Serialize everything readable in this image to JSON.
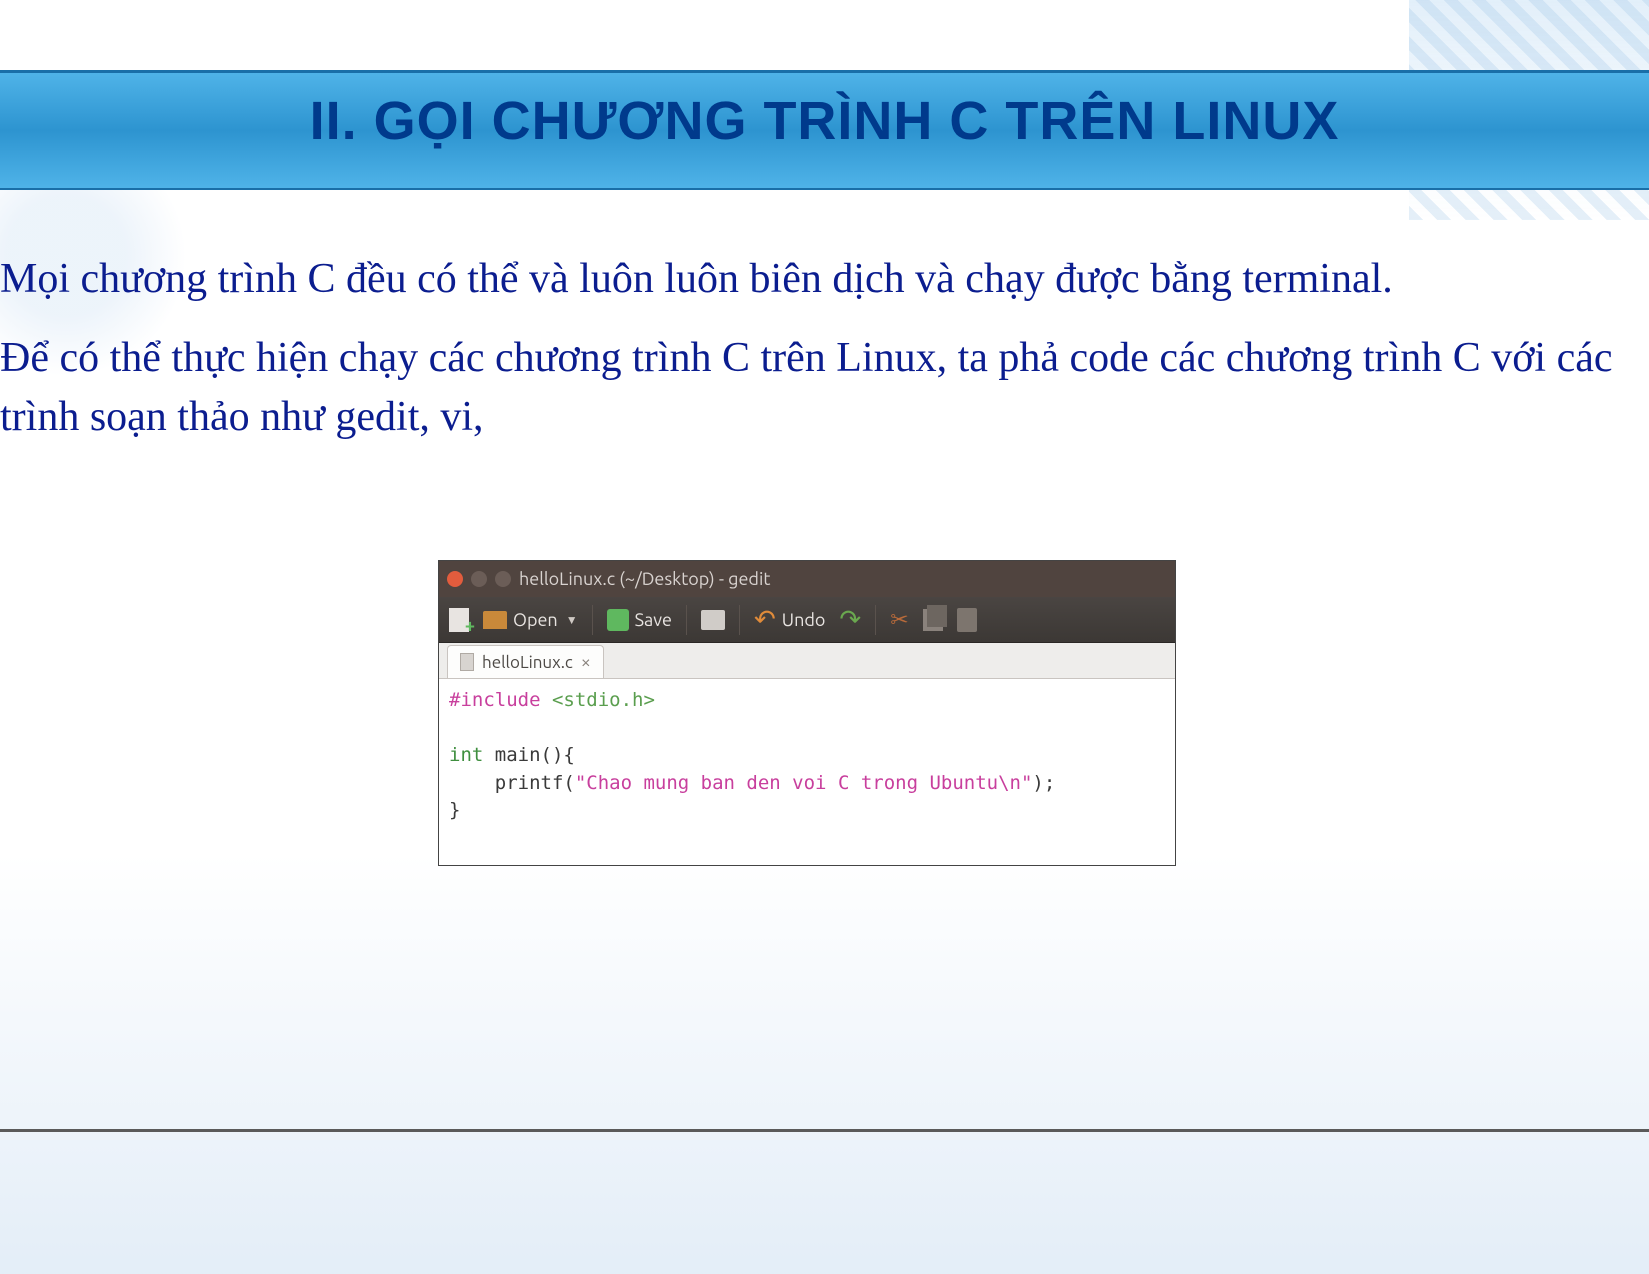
{
  "slide": {
    "title": "II. GỌI CHƯƠNG TRÌNH C TRÊN LINUX",
    "paragraph1": "Mọi chương trình C đều có thể và luôn luôn biên dịch và chạy được bằng terminal.",
    "paragraph2": "Để có thể thực hiện chạy các chương trình C trên Linux, ta phả code các chương trình C với các trình soạn thảo như gedit, vi,"
  },
  "editor": {
    "window_title": "helloLinux.c (~/Desktop) - gedit",
    "toolbar": {
      "open": "Open",
      "save": "Save",
      "undo": "Undo"
    },
    "tab": {
      "filename": "helloLinux.c",
      "close_glyph": "×"
    },
    "code": {
      "include_directive": "#include",
      "include_header": "<stdio.h>",
      "type_int": "int",
      "main_sig": " main(){",
      "printf_call_pre": "    printf(",
      "printf_string": "\"Chao mung ban den voi C trong Ubuntu\\n\"",
      "printf_call_post": ");",
      "close_brace": "}"
    }
  }
}
